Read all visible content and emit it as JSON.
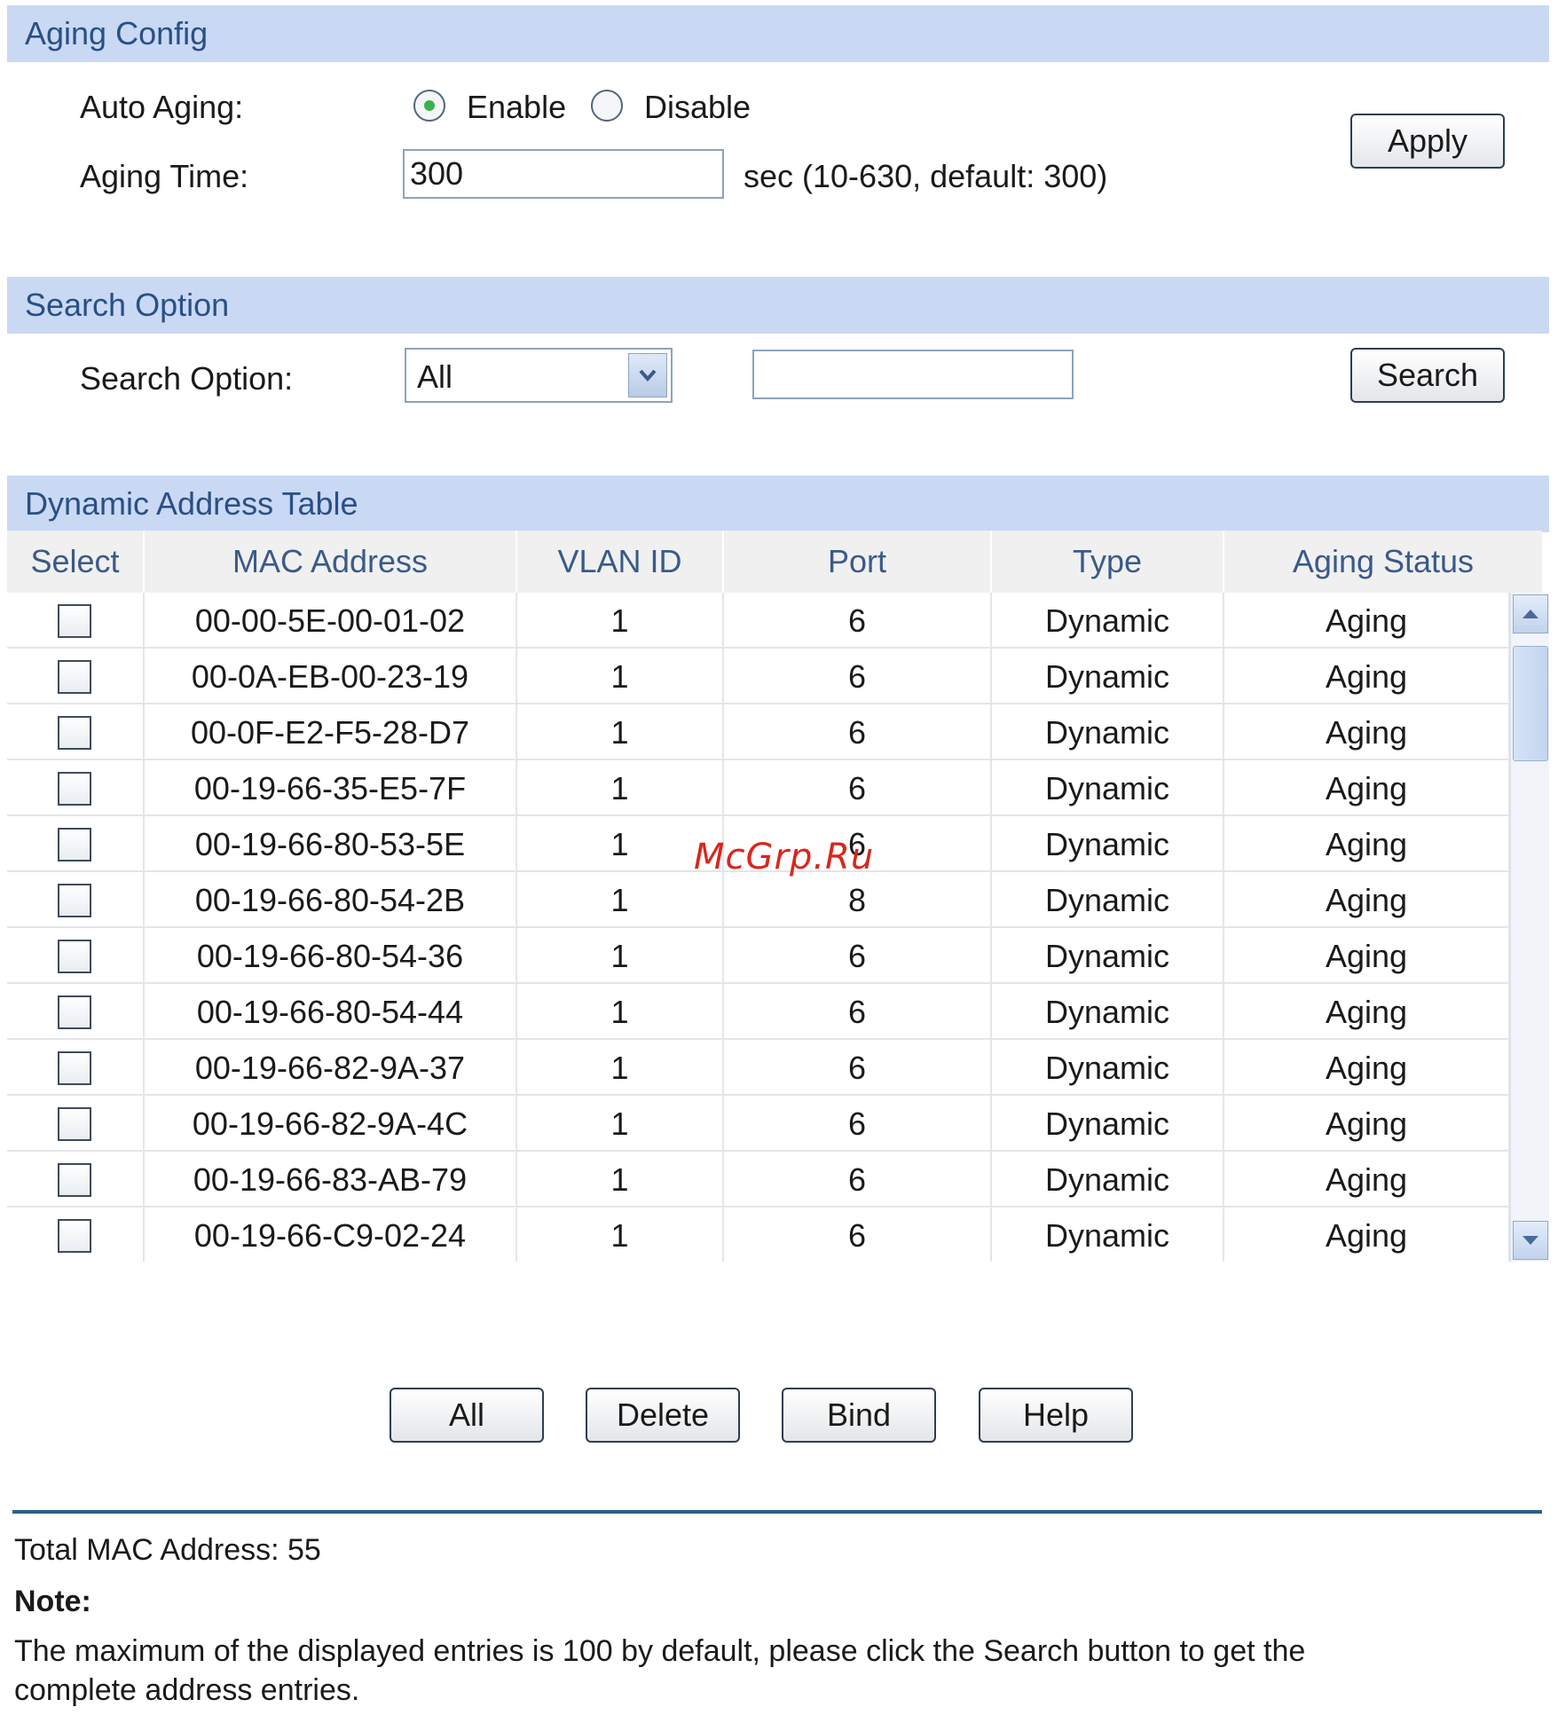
{
  "aging_config": {
    "title": "Aging Config",
    "auto_aging_label": "Auto Aging:",
    "enable_label": "Enable",
    "disable_label": "Disable",
    "auto_aging_selected": "Enable",
    "aging_time_label": "Aging Time:",
    "aging_time_value": "300",
    "aging_time_hint": "sec (10-630, default: 300)",
    "apply_label": "Apply"
  },
  "search_option": {
    "title": "Search Option",
    "label": "Search Option:",
    "selected": "All",
    "search_value": "",
    "search_button": "Search"
  },
  "dynamic_table": {
    "title": "Dynamic Address Table",
    "columns": [
      "Select",
      "MAC Address",
      "VLAN ID",
      "Port",
      "Type",
      "Aging Status"
    ],
    "rows": [
      {
        "mac": "00-00-5E-00-01-02",
        "vlan": "1",
        "port": "6",
        "type": "Dynamic",
        "status": "Aging"
      },
      {
        "mac": "00-0A-EB-00-23-19",
        "vlan": "1",
        "port": "6",
        "type": "Dynamic",
        "status": "Aging"
      },
      {
        "mac": "00-0F-E2-F5-28-D7",
        "vlan": "1",
        "port": "6",
        "type": "Dynamic",
        "status": "Aging"
      },
      {
        "mac": "00-19-66-35-E5-7F",
        "vlan": "1",
        "port": "6",
        "type": "Dynamic",
        "status": "Aging"
      },
      {
        "mac": "00-19-66-80-53-5E",
        "vlan": "1",
        "port": "6",
        "type": "Dynamic",
        "status": "Aging"
      },
      {
        "mac": "00-19-66-80-54-2B",
        "vlan": "1",
        "port": "8",
        "type": "Dynamic",
        "status": "Aging"
      },
      {
        "mac": "00-19-66-80-54-36",
        "vlan": "1",
        "port": "6",
        "type": "Dynamic",
        "status": "Aging"
      },
      {
        "mac": "00-19-66-80-54-44",
        "vlan": "1",
        "port": "6",
        "type": "Dynamic",
        "status": "Aging"
      },
      {
        "mac": "00-19-66-82-9A-37",
        "vlan": "1",
        "port": "6",
        "type": "Dynamic",
        "status": "Aging"
      },
      {
        "mac": "00-19-66-82-9A-4C",
        "vlan": "1",
        "port": "6",
        "type": "Dynamic",
        "status": "Aging"
      },
      {
        "mac": "00-19-66-83-AB-79",
        "vlan": "1",
        "port": "6",
        "type": "Dynamic",
        "status": "Aging"
      },
      {
        "mac": "00-19-66-C9-02-24",
        "vlan": "1",
        "port": "6",
        "type": "Dynamic",
        "status": "Aging"
      }
    ]
  },
  "actions": {
    "all": "All",
    "delete": "Delete",
    "bind": "Bind",
    "help": "Help"
  },
  "footer": {
    "total": "Total MAC Address: 55",
    "note_title": "Note:",
    "note_line1": "The maximum of the displayed entries is 100 by default, please click the Search button to get the",
    "note_line2": "complete address entries."
  },
  "watermark": "McGrp.Ru",
  "icons": {
    "select_arrow": "chevron-down-icon",
    "scroll_up": "arrow-up-icon",
    "scroll_down": "arrow-down-icon"
  },
  "colors": {
    "section_bar": "#c9d9f3",
    "section_title": "#2a4f86",
    "header_text": "#3a5a8a",
    "radio_dot": "#3cb14a",
    "divider": "#2c5f8c",
    "watermark": "#d9261c"
  }
}
